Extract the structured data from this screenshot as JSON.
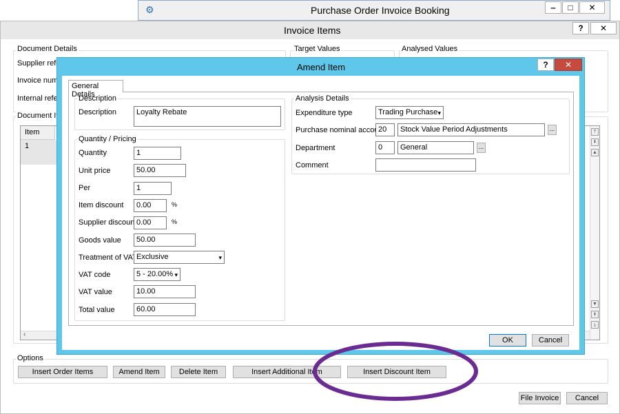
{
  "back_window": {
    "title": "Purchase Order Invoice Booking",
    "controls": {
      "minimize": "‒",
      "maximize": "□",
      "close": "✕"
    }
  },
  "invoice_window": {
    "title": "Invoice Items",
    "help": "?",
    "close": "✕",
    "document_details_label": "Document Details",
    "supplier_reference_label": "Supplier refere",
    "invoice_number_label": "Invoice numbe",
    "internal_reference_label": "Internal referen",
    "target_values_label": "Target Values",
    "analysed_values_label": "Analysed Values",
    "document_items_label": "Document Iten",
    "grid": {
      "header": "Item",
      "rows": [
        "1"
      ]
    },
    "options_label": "Options",
    "buttons": {
      "insert_order_items": "Insert Order Items",
      "amend_item": "Amend Item",
      "delete_item": "Delete Item",
      "insert_additional_item": "Insert Additional Item",
      "insert_discount_item": "Insert Discount Item",
      "file_invoice": "File Invoice",
      "cancel": "Cancel"
    }
  },
  "amend_dialog": {
    "title": "Amend Item",
    "help": "?",
    "close": "✕",
    "tab": "General Details",
    "description_group": "Description",
    "description_label": "Description",
    "description_value": "Loyalty Rebate",
    "qp_group": "Quantity / Pricing",
    "quantity_label": "Quantity",
    "quantity_value": "1",
    "unit_price_label": "Unit price",
    "unit_price_value": "50.00",
    "per_label": "Per",
    "per_value": "1",
    "item_discount_label": "Item discount",
    "item_discount_value": "0.00",
    "supplier_discount_label": "Supplier discount",
    "supplier_discount_value": "0.00",
    "percent": "%",
    "goods_value_label": "Goods value",
    "goods_value": "50.00",
    "treatment_label": "Treatment of VAT",
    "treatment_value": "Exclusive",
    "vat_code_label": "VAT code",
    "vat_code_value": "5 - 20.00%",
    "vat_value_label": "VAT value",
    "vat_value": "10.00",
    "total_value_label": "Total value",
    "total_value": "60.00",
    "analysis_group": "Analysis Details",
    "expenditure_label": "Expenditure type",
    "expenditure_value": "Trading Purchase",
    "nominal_label": "Purchase nominal account",
    "nominal_code": "20",
    "nominal_name": "Stock Value Period Adjustments",
    "department_label": "Department",
    "department_code": "0",
    "department_name": "General",
    "comment_label": "Comment",
    "comment_value": "",
    "ellipsis": "...",
    "ok": "OK",
    "cancel": "Cancel"
  },
  "colors": {
    "dialog_frame": "#5ec7ea",
    "annotation": "#6a2c91",
    "titlebar": "#e8e8e8"
  }
}
